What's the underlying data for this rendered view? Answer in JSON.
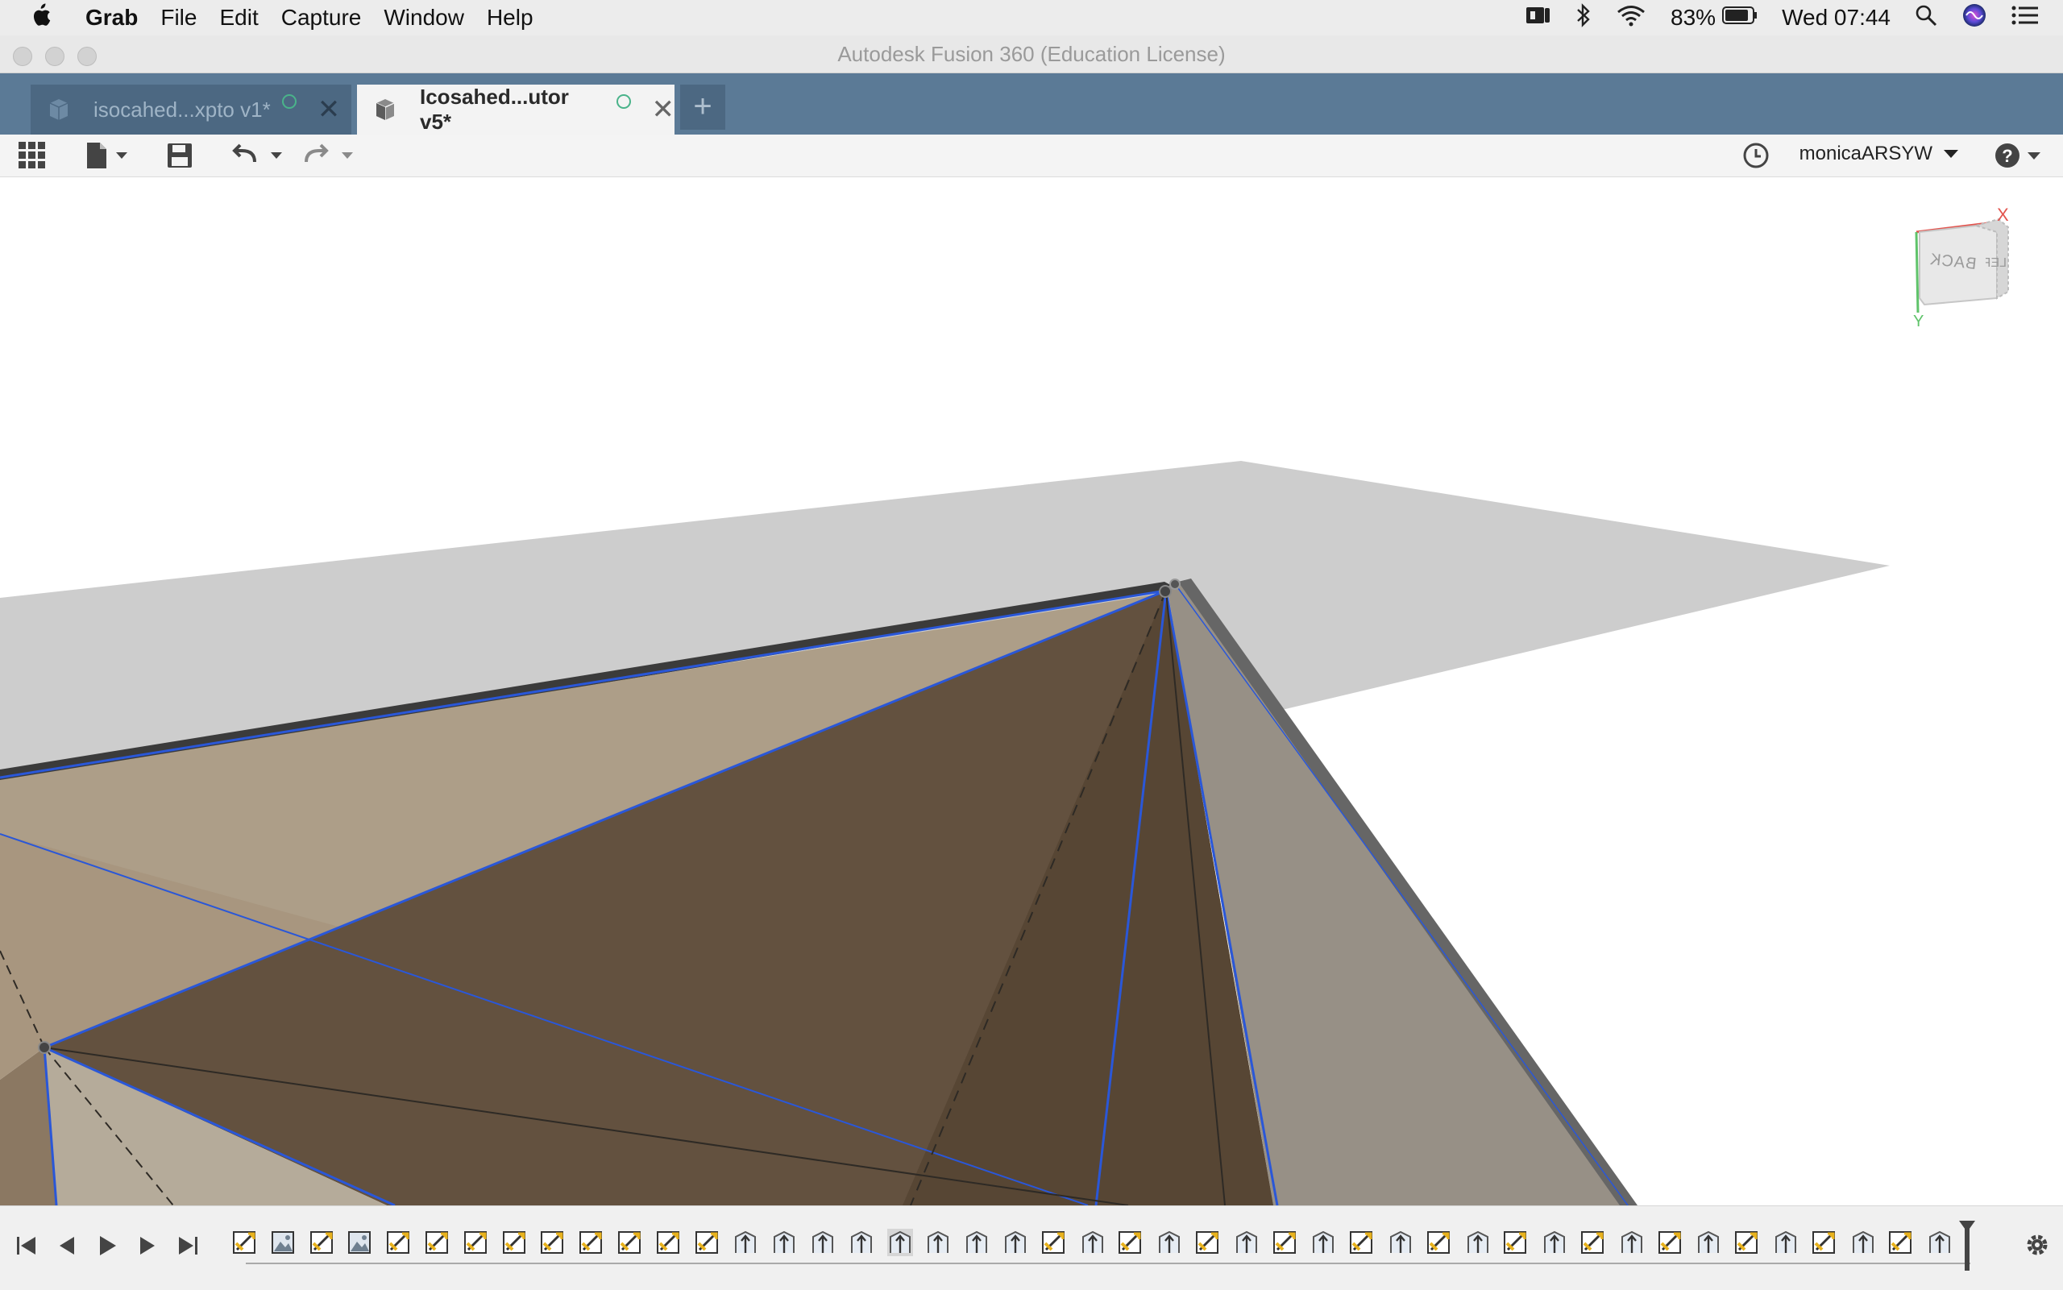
{
  "menubar": {
    "app_name": "Grab",
    "items": [
      "File",
      "Edit",
      "Capture",
      "Window",
      "Help"
    ],
    "battery": "83%",
    "clock": "Wed 07:44"
  },
  "window": {
    "title": "Autodesk Fusion 360 (Education License)"
  },
  "tabs": [
    {
      "label": "isocahed...xpto v1*",
      "active": false
    },
    {
      "label": "Icosahed...utor v5*",
      "active": true
    }
  ],
  "toolbar": {
    "user": "monicaARSYW"
  },
  "viewcube": {
    "face_label": "BACK",
    "side_label": "LEFT",
    "axis_x": "X",
    "axis_y": "Y"
  },
  "timeline": {
    "feature_sequence": [
      "sketch",
      "image",
      "sketch",
      "image",
      "sketch",
      "sketch",
      "sketch",
      "sketch",
      "sketch",
      "sketch",
      "sketch",
      "sketch",
      "sketch",
      "extrude",
      "extrude",
      "extrude",
      "extrude",
      "extrude",
      "extrude",
      "extrude",
      "extrude",
      "sketch",
      "extrude",
      "sketch",
      "extrude",
      "sketch",
      "extrude",
      "sketch",
      "extrude",
      "sketch",
      "extrude",
      "sketch",
      "extrude",
      "sketch",
      "extrude",
      "sketch",
      "extrude",
      "sketch",
      "extrude",
      "sketch",
      "extrude",
      "sketch",
      "extrude",
      "sketch",
      "extrude"
    ]
  },
  "colors": {
    "tabbar": "#5b7a96",
    "accent": "#2f6fe0"
  }
}
